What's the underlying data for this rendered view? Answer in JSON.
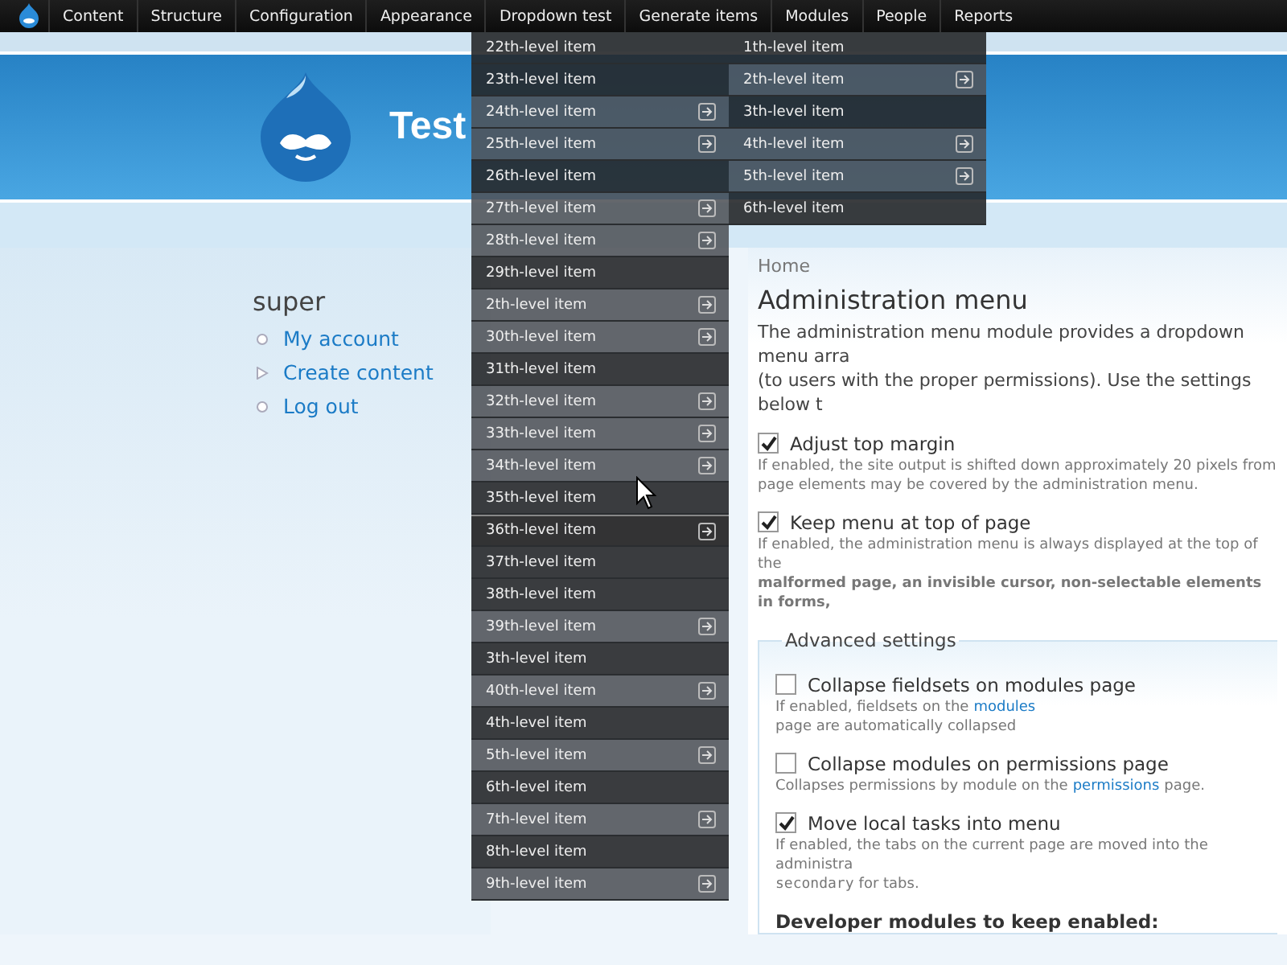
{
  "admin_bar": {
    "items": [
      {
        "label": "Content"
      },
      {
        "label": "Structure"
      },
      {
        "label": "Configuration"
      },
      {
        "label": "Appearance"
      },
      {
        "label": "Dropdown test"
      },
      {
        "label": "Generate items"
      },
      {
        "label": "Modules"
      },
      {
        "label": "People"
      },
      {
        "label": "Reports"
      }
    ]
  },
  "dropdowns": [
    {
      "items": [
        {
          "label": "22th-level item",
          "expandable": false,
          "hovered": false
        },
        {
          "label": "23th-level item",
          "expandable": false,
          "hovered": false
        },
        {
          "label": "24th-level item",
          "expandable": true,
          "hovered": false
        },
        {
          "label": "25th-level item",
          "expandable": true,
          "hovered": false
        },
        {
          "label": "26th-level item",
          "expandable": false,
          "hovered": false
        },
        {
          "label": "27th-level item",
          "expandable": true,
          "hovered": false
        },
        {
          "label": "28th-level item",
          "expandable": true,
          "hovered": false
        },
        {
          "label": "29th-level item",
          "expandable": false,
          "hovered": false
        },
        {
          "label": "2th-level item",
          "expandable": true,
          "hovered": false
        },
        {
          "label": "30th-level item",
          "expandable": true,
          "hovered": false
        },
        {
          "label": "31th-level item",
          "expandable": false,
          "hovered": false
        },
        {
          "label": "32th-level item",
          "expandable": true,
          "hovered": false
        },
        {
          "label": "33th-level item",
          "expandable": true,
          "hovered": false
        },
        {
          "label": "34th-level item",
          "expandable": true,
          "hovered": false
        },
        {
          "label": "35th-level item",
          "expandable": false,
          "hovered": false
        },
        {
          "label": "36th-level item",
          "expandable": true,
          "hovered": true
        },
        {
          "label": "37th-level item",
          "expandable": false,
          "hovered": false
        },
        {
          "label": "38th-level item",
          "expandable": false,
          "hovered": false
        },
        {
          "label": "39th-level item",
          "expandable": true,
          "hovered": false
        },
        {
          "label": "3th-level item",
          "expandable": false,
          "hovered": false
        },
        {
          "label": "40th-level item",
          "expandable": true,
          "hovered": false
        },
        {
          "label": "4th-level item",
          "expandable": false,
          "hovered": false
        },
        {
          "label": "5th-level item",
          "expandable": true,
          "hovered": false
        },
        {
          "label": "6th-level item",
          "expandable": false,
          "hovered": false
        },
        {
          "label": "7th-level item",
          "expandable": true,
          "hovered": false
        },
        {
          "label": "8th-level item",
          "expandable": false,
          "hovered": false
        },
        {
          "label": "9th-level item",
          "expandable": true,
          "hovered": false
        }
      ]
    },
    {
      "items": [
        {
          "label": "1th-level item",
          "expandable": false,
          "hovered": false
        },
        {
          "label": "2th-level item",
          "expandable": true,
          "hovered": false
        },
        {
          "label": "3th-level item",
          "expandable": false,
          "hovered": false
        },
        {
          "label": "4th-level item",
          "expandable": true,
          "hovered": false
        },
        {
          "label": "5th-level item",
          "expandable": true,
          "hovered": false
        },
        {
          "label": "6th-level item",
          "expandable": false,
          "hovered": false
        }
      ]
    }
  ],
  "header": {
    "site_name": "Test"
  },
  "sidebar": {
    "username": "super",
    "links": [
      {
        "label": "My account",
        "kind": "leaf"
      },
      {
        "label": "Create content",
        "kind": "collapsed"
      },
      {
        "label": "Log out",
        "kind": "leaf"
      }
    ]
  },
  "main": {
    "breadcrumb": "Home",
    "title": "Administration menu",
    "intro_lines": [
      "The administration menu module provides a dropdown menu arra",
      "(to users with the proper permissions). Use the settings below t"
    ],
    "options": [
      {
        "label": "Adjust top margin",
        "checked": true,
        "description_lines": [
          [
            {
              "kind": "text",
              "text": "If enabled, the site output is shifted down approximately 20 pixels from"
            }
          ],
          [
            {
              "kind": "text",
              "text": "page elements may be covered by the administration menu."
            }
          ]
        ]
      },
      {
        "label": "Keep menu at top of page",
        "checked": true,
        "description_lines": [
          [
            {
              "kind": "text",
              "text": "If enabled, the administration menu is always displayed at the top of the"
            }
          ],
          [
            {
              "kind": "strong",
              "text": "malformed page, an invisible cursor, non-selectable elements in forms,"
            }
          ]
        ]
      }
    ],
    "fieldset": {
      "legend": "Advanced settings",
      "options": [
        {
          "label": "Collapse fieldsets on modules page",
          "checked": false,
          "description_lines": [
            [
              {
                "kind": "text",
                "text": "If enabled, fieldsets on the "
              },
              {
                "kind": "link",
                "text": "modules"
              },
              {
                "kind": "text",
                "text": " page are automatically collapsed"
              }
            ]
          ]
        },
        {
          "label": "Collapse modules on permissions page",
          "checked": false,
          "description_lines": [
            [
              {
                "kind": "text",
                "text": "Collapses permissions by module on the "
              },
              {
                "kind": "link",
                "text": "permissions"
              },
              {
                "kind": "text",
                "text": " page."
              }
            ]
          ]
        },
        {
          "label": "Move local tasks into menu",
          "checked": true,
          "description_lines": [
            [
              {
                "kind": "text",
                "text": "If enabled, the tabs on the current page are moved into the administra"
              }
            ],
            [
              {
                "kind": "code",
                "text": "secondary"
              },
              {
                "kind": "text",
                "text": " for tabs."
              }
            ]
          ]
        }
      ],
      "subheading": "Developer modules to keep enabled:"
    }
  }
}
